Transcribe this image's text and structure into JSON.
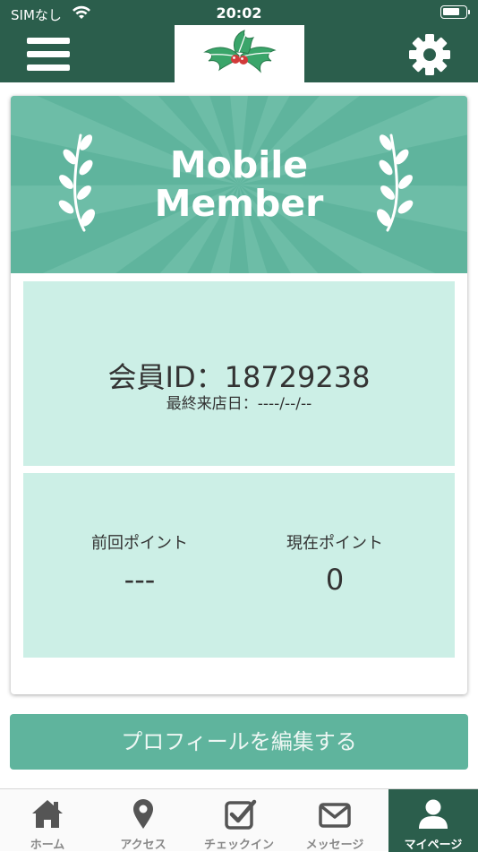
{
  "status_bar": {
    "carrier": "SIMなし",
    "time": "20:02"
  },
  "header": {
    "menu_icon": "hamburger-menu-icon",
    "logo": "holly-logo",
    "settings_icon": "gear-icon"
  },
  "card": {
    "banner_title_line1": "Mobile",
    "banner_title_line2": "Member",
    "member_id": "会員ID：18729238",
    "last_visit": "最終来店日：----/--/--",
    "previous_points_label": "前回ポイント",
    "previous_points_value": "---",
    "current_points_label": "現在ポイント",
    "current_points_value": "0"
  },
  "edit_profile_label": "プロフィールを編集する",
  "tabs": [
    {
      "label": "ホーム",
      "icon": "home-icon"
    },
    {
      "label": "アクセス",
      "icon": "map-pin-icon"
    },
    {
      "label": "チェックイン",
      "icon": "checkin-icon"
    },
    {
      "label": "メッセージ",
      "icon": "envelope-icon"
    },
    {
      "label": "マイページ",
      "icon": "user-icon",
      "active": true
    }
  ],
  "colors": {
    "header_bg": "#2b5e4c",
    "accent": "#5fb49d",
    "panel_bg": "#ccefe6"
  }
}
